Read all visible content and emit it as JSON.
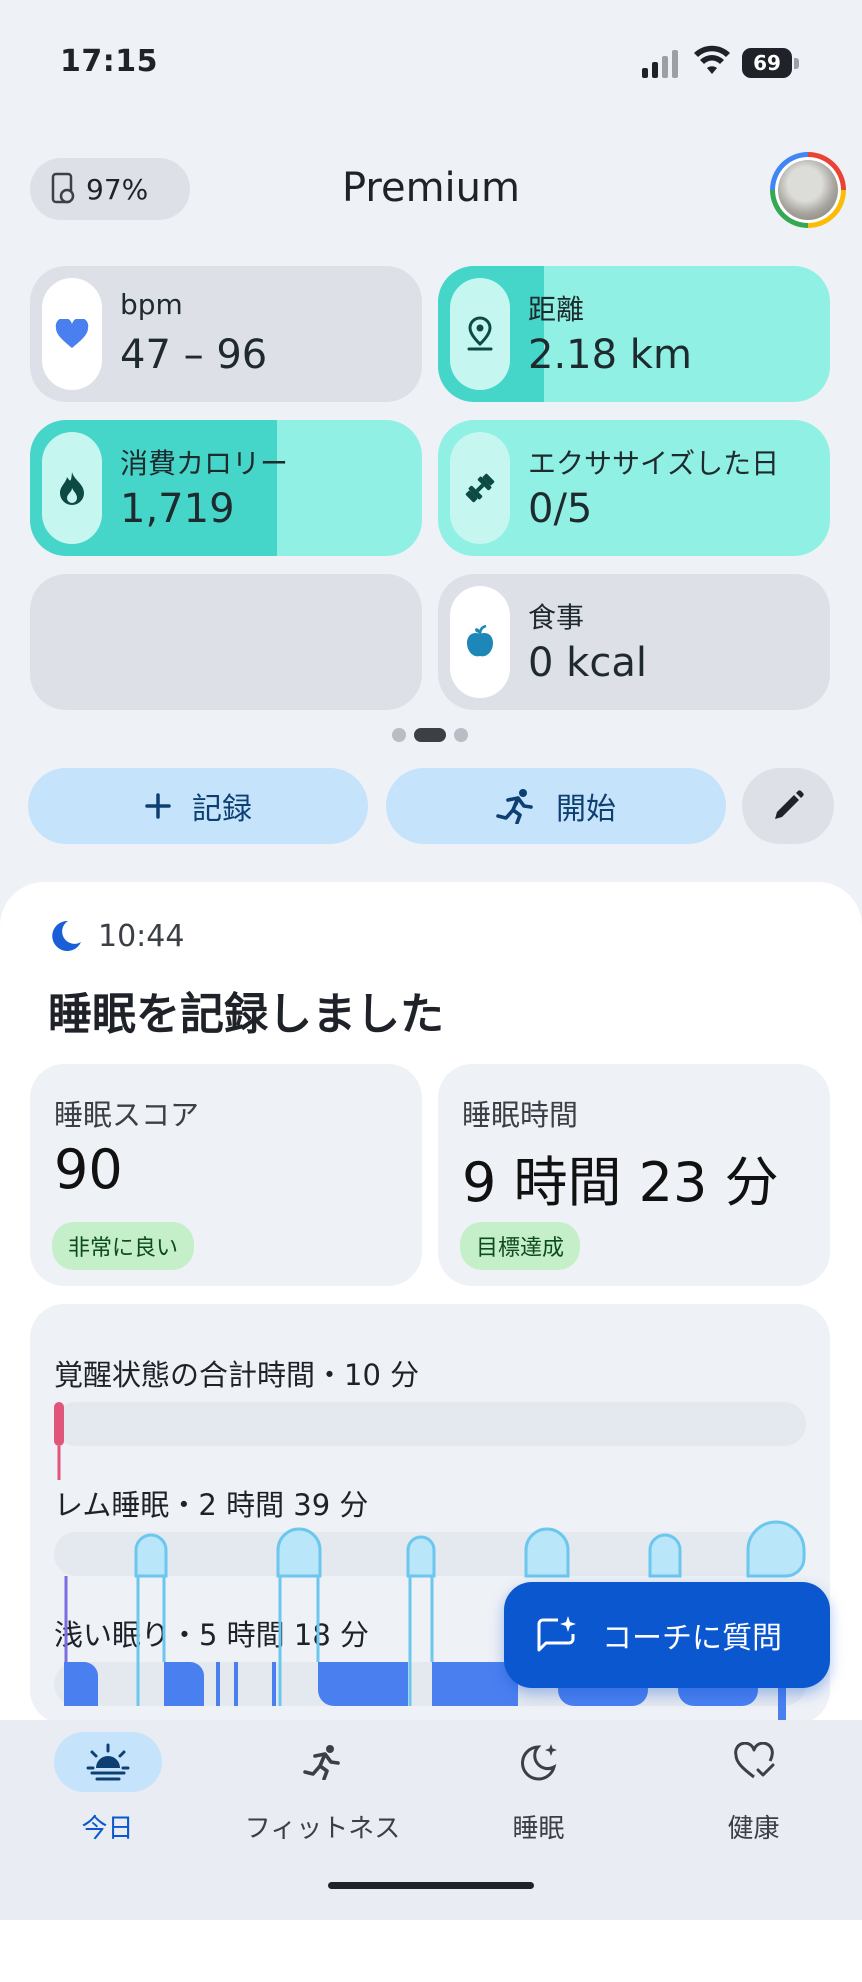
{
  "status_bar": {
    "time": "17:15",
    "battery": "69"
  },
  "header": {
    "device_battery": "97%",
    "title": "Premium"
  },
  "tiles": [
    {
      "label": "bpm",
      "value": "47 – 96",
      "icon": "heart-icon",
      "highlight": false,
      "fill": 0
    },
    {
      "label": "距離",
      "value": "2.18 km",
      "icon": "location-pin-icon",
      "highlight": true,
      "fill": 0.27
    },
    {
      "label": "消費カロリー",
      "value": "1,719",
      "icon": "flame-icon",
      "highlight": true,
      "fill": 0.63
    },
    {
      "label": "エクササイズした日",
      "value": "0/5",
      "icon": "dumbbell-icon",
      "highlight": true,
      "fill": 0
    },
    {
      "label": "",
      "value": "",
      "icon": "",
      "highlight": false,
      "fill": 0
    },
    {
      "label": "食事",
      "value": "0 kcal",
      "icon": "apple-icon",
      "highlight": false,
      "fill": 0
    }
  ],
  "pager": {
    "pages": 3,
    "current": 2
  },
  "actions": {
    "record_label": "記録",
    "start_label": "開始"
  },
  "sleep": {
    "time": "10:44",
    "title": "睡眠を記録しました",
    "score": {
      "label": "睡眠スコア",
      "value": "90",
      "badge": "非常に良い"
    },
    "duration": {
      "label": "睡眠時間",
      "value": "9 時間 23 分",
      "badge": "目標達成"
    },
    "stages": [
      {
        "label": "覚醒状態の合計時間・10 分"
      },
      {
        "label": "レム睡眠・2 時間 39 分"
      },
      {
        "label": "浅い眠り・5 時間 18 分"
      }
    ]
  },
  "coach": {
    "label": "コーチに質問"
  },
  "nav": [
    {
      "label": "今日",
      "icon": "sunrise-icon",
      "active": true
    },
    {
      "label": "フィットネス",
      "icon": "running-icon",
      "active": false
    },
    {
      "label": "睡眠",
      "icon": "moon-sparkle-icon",
      "active": false
    },
    {
      "label": "健康",
      "icon": "heart-check-icon",
      "active": false
    }
  ],
  "colors": {
    "teal_tile": "#8ff0e3",
    "teal_fill": "#46d5c9",
    "accent_blue": "#0b57d0",
    "awake": "#e0567b",
    "rem": "#7ecff2",
    "light": "#4a7ff0"
  }
}
